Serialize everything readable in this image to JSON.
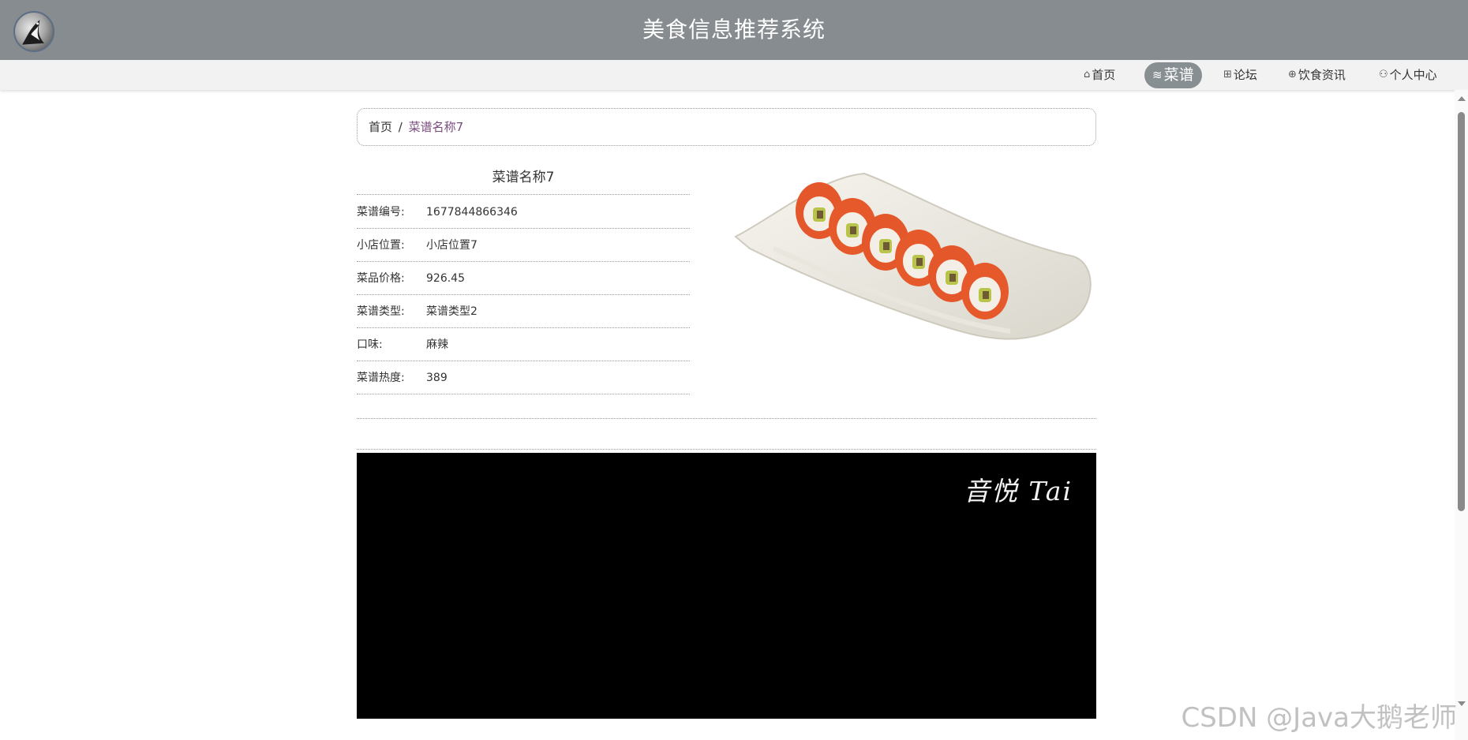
{
  "header": {
    "title": "美食信息推荐系统",
    "logo_icon": "penguin-logo-icon"
  },
  "nav": {
    "items": [
      {
        "label": "首页",
        "icon": "home-icon",
        "glyph": "⌂"
      },
      {
        "label": "菜谱",
        "icon": "layers-icon",
        "glyph": "≋",
        "active": true
      },
      {
        "label": "论坛",
        "icon": "forum-icon",
        "glyph": "⊞"
      },
      {
        "label": "饮食资讯",
        "icon": "globe-icon",
        "glyph": "⊕"
      },
      {
        "label": "个人中心",
        "icon": "user-icon",
        "glyph": "⚇"
      }
    ],
    "active_color": "#888f92"
  },
  "breadcrumb": {
    "home": "首页",
    "separator": "/",
    "current": "菜谱名称7",
    "current_color": "#7a4a7e"
  },
  "detail": {
    "name": "菜谱名称7",
    "rows": [
      {
        "label": "菜谱编号:",
        "value": "1677844866346"
      },
      {
        "label": "小店位置:",
        "value": "小店位置7"
      },
      {
        "label": "菜品价格:",
        "value": "926.45"
      },
      {
        "label": "菜谱类型:",
        "value": "菜谱类型2"
      },
      {
        "label": "口味:",
        "value": "麻辣"
      },
      {
        "label": "菜谱热度:",
        "value": "389"
      }
    ],
    "image": "sushi-roll-photo"
  },
  "video": {
    "watermark": "音悦 Tai"
  },
  "page_watermark": "CSDN @Java大鹅老师",
  "colors": {
    "header_bg": "#868c8f",
    "nav_bg": "#f2f2f2"
  }
}
